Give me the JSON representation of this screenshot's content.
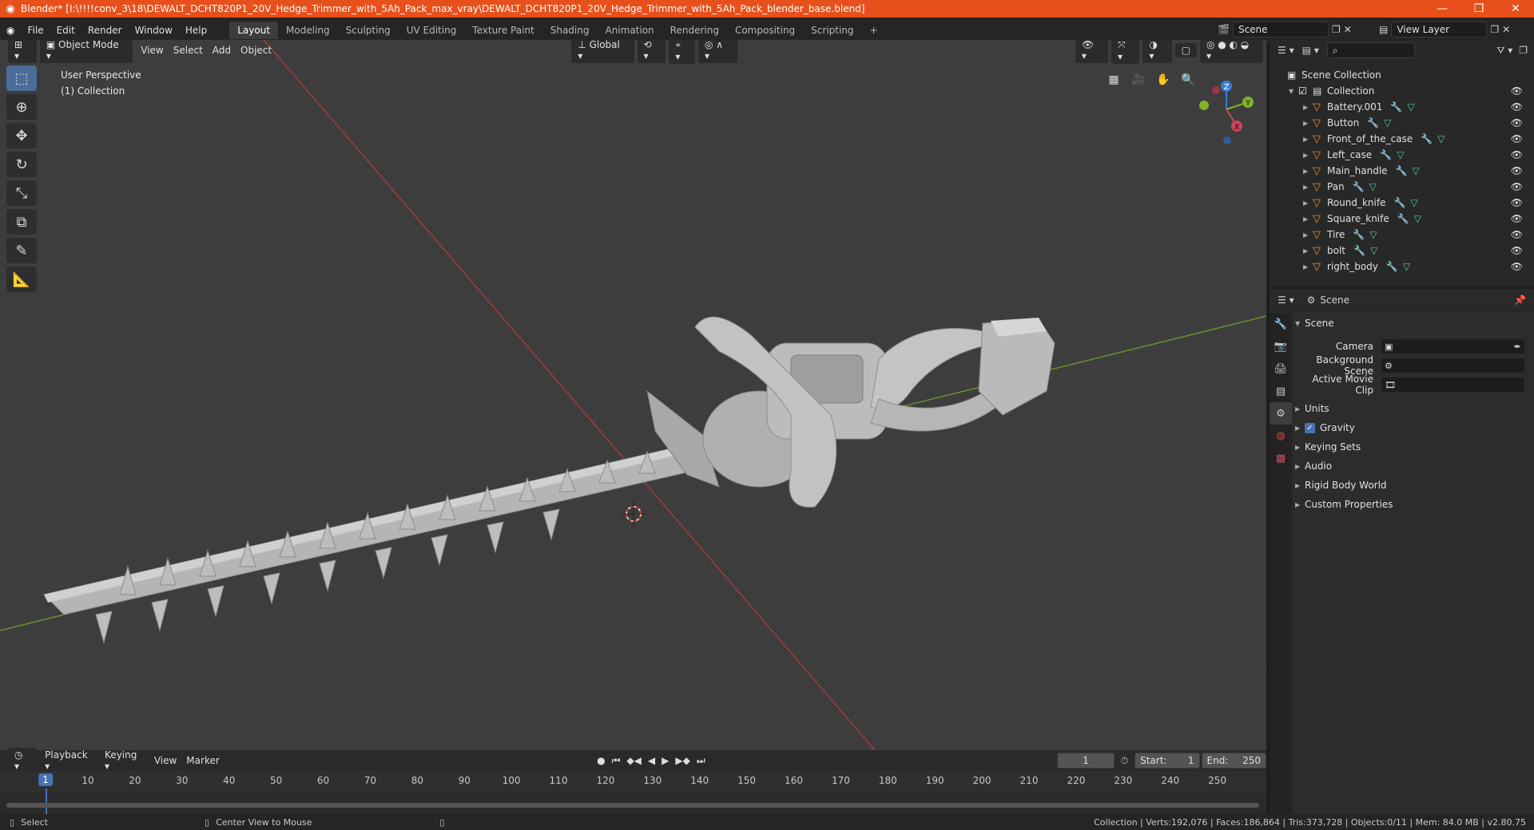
{
  "titlebar": {
    "title": "Blender* [I:\\!!!!conv_3\\18\\DEWALT_DCHT820P1_20V_Hedge_Trimmer_with_5Ah_Pack_max_vray\\DEWALT_DCHT820P1_20V_Hedge_Trimmer_with_5Ah_Pack_blender_base.blend]",
    "minimize": "—",
    "maximize": "❐",
    "close": "✕"
  },
  "menu": [
    "File",
    "Edit",
    "Render",
    "Window",
    "Help"
  ],
  "workspaces": [
    "Layout",
    "Modeling",
    "Sculpting",
    "UV Editing",
    "Texture Paint",
    "Shading",
    "Animation",
    "Rendering",
    "Compositing",
    "Scripting"
  ],
  "active_workspace": "Layout",
  "scene_field": "Scene",
  "view_layer_field": "View Layer",
  "viewport": {
    "mode": "Object Mode",
    "menus": [
      "View",
      "Select",
      "Add",
      "Object"
    ],
    "orientation": "Global",
    "info_line1": "User Perspective",
    "info_line2": "(1) Collection",
    "gizmo": {
      "z": "Z",
      "y": "Y",
      "x": "X"
    }
  },
  "outliner": {
    "root": "Scene Collection",
    "collection": "Collection",
    "objects": [
      "Battery.001",
      "Button",
      "Front_of_the_case",
      "Left_case",
      "Main_handle",
      "Pan",
      "Round_knife",
      "Square_knife",
      "Tire",
      "bolt",
      "right_body"
    ]
  },
  "properties": {
    "header": "Scene",
    "panel_title": "Scene",
    "fields": [
      {
        "label": "Camera"
      },
      {
        "label": "Background Scene"
      },
      {
        "label": "Active Movie Clip"
      }
    ],
    "subpanels": [
      "Units",
      "Gravity",
      "Keying Sets",
      "Audio",
      "Rigid Body World",
      "Custom Properties"
    ],
    "gravity_checked": true
  },
  "timeline": {
    "menus": [
      "Playback",
      "Keying",
      "View",
      "Marker"
    ],
    "current_frame": "1",
    "start_label": "Start:",
    "start": "1",
    "end_label": "End:",
    "end": "250",
    "ticks": [
      "1",
      "10",
      "20",
      "30",
      "40",
      "50",
      "60",
      "70",
      "80",
      "90",
      "100",
      "110",
      "120",
      "130",
      "140",
      "150",
      "160",
      "170",
      "180",
      "190",
      "200",
      "210",
      "220",
      "230",
      "240",
      "250"
    ]
  },
  "statusbar": {
    "select": "Select",
    "center_view": "Center View to Mouse",
    "stats": "Collection | Verts:192,076 | Faces:186,864 | Tris:373,728 | Objects:0/11 | Mem: 84.0 MB | v2.80.75"
  }
}
